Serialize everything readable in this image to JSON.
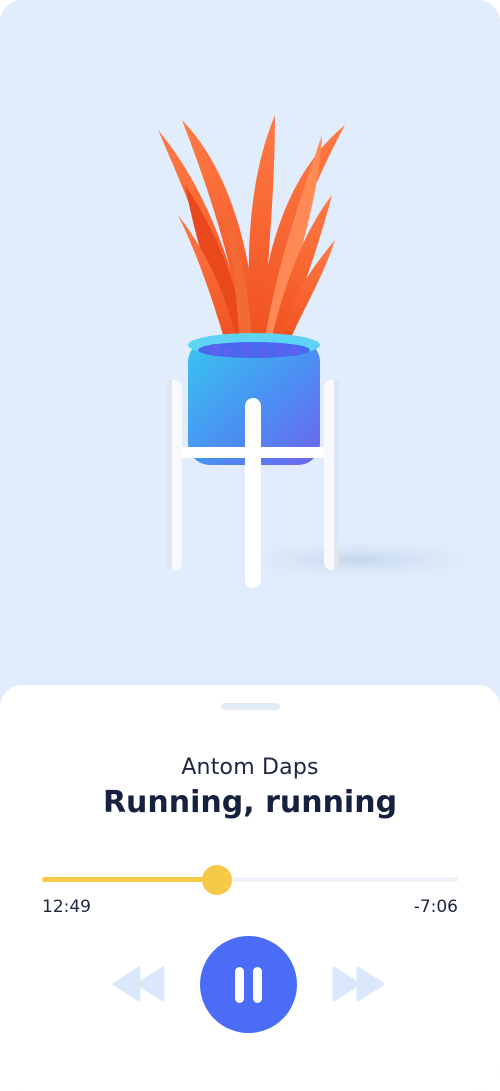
{
  "artwork": {
    "description_icon": "potted-plant-artwork"
  },
  "player": {
    "artist": "Antom Daps",
    "track_title": "Running, running",
    "elapsed": "12:49",
    "remaining": "-7:06",
    "progress": 0.42
  },
  "controls": {
    "prev_icon": "rewind-icon",
    "play_icon": "pause-icon",
    "next_icon": "fast-forward-icon"
  },
  "colors": {
    "background": "#e1edfc",
    "accent": "#4a6cf7",
    "progress": "#f7c948",
    "text": "#16203f"
  }
}
